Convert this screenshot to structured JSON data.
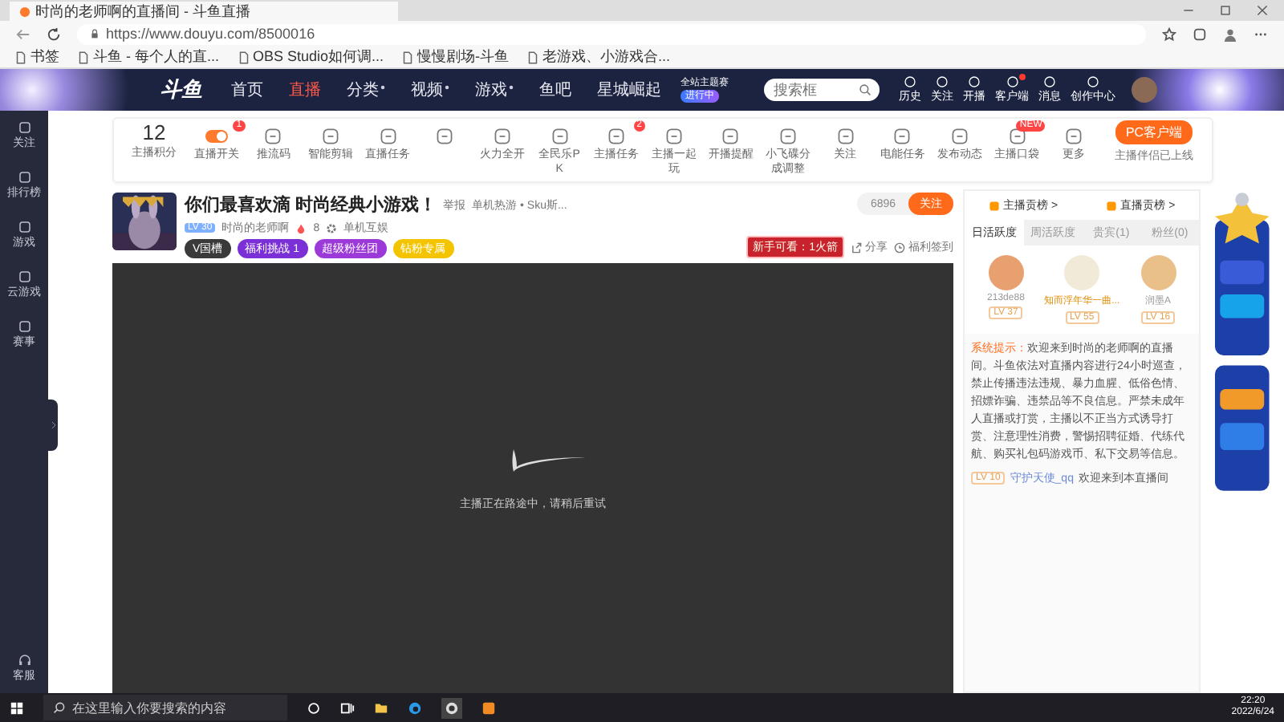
{
  "browser": {
    "tab_title": "时尚的老师啊的直播间 - 斗鱼直播",
    "url": "https://www.douyu.com/8500016",
    "bookmarks": [
      "书签",
      "斗鱼 - 每个人的直...",
      "OBS Studio如何调...",
      "慢慢剧场-斗鱼",
      "老游戏、小游戏合..."
    ]
  },
  "header": {
    "logo": "斗鱼",
    "nav": [
      {
        "label": "首页",
        "selected": false,
        "dropdown": false
      },
      {
        "label": "直播",
        "selected": true,
        "dropdown": false
      },
      {
        "label": "分类",
        "selected": false,
        "dropdown": true
      },
      {
        "label": "视频",
        "selected": false,
        "dropdown": true
      },
      {
        "label": "游戏",
        "selected": false,
        "dropdown": true
      },
      {
        "label": "鱼吧",
        "selected": false,
        "dropdown": false
      },
      {
        "label": "星城崛起",
        "selected": false,
        "dropdown": false
      }
    ],
    "event": {
      "title": "全站主题赛",
      "status": "进行中"
    },
    "search": {
      "placeholder": "搜索框"
    },
    "actions": [
      {
        "label": "历史",
        "notify": false
      },
      {
        "label": "关注",
        "notify": false
      },
      {
        "label": "开播",
        "notify": false
      },
      {
        "label": "客户端",
        "notify": true
      },
      {
        "label": "消息",
        "notify": false
      },
      {
        "label": "创作中心",
        "notify": false
      }
    ]
  },
  "sidebar": {
    "items": [
      "关注",
      "排行榜",
      "游戏",
      "云游戏",
      "赛事"
    ],
    "bottom": "客服"
  },
  "toolbar": {
    "score": "12",
    "score_label": "主播积分",
    "items": [
      {
        "label": "直播开关",
        "kind": "toggle",
        "on": true,
        "badge": "1"
      },
      {
        "label": "推流码",
        "kind": "icon"
      },
      {
        "label": "智能剪辑",
        "kind": "icon"
      },
      {
        "label": "直播任务",
        "kind": "icon"
      },
      {
        "kind": "icon"
      },
      {
        "label": "火力全开",
        "kind": "icon"
      },
      {
        "label": "全民乐PK",
        "kind": "icon"
      },
      {
        "label": "主播任务",
        "kind": "icon",
        "badge": "2"
      },
      {
        "label": "主播一起玩",
        "kind": "icon"
      },
      {
        "label": "开播提醒",
        "kind": "icon"
      },
      {
        "label": "小飞碟分成调整",
        "kind": "icon"
      },
      {
        "label": "关注",
        "kind": "icon"
      },
      {
        "label": "电能任务",
        "kind": "icon"
      },
      {
        "label": "发布动态",
        "kind": "icon"
      },
      {
        "label": "主播口袋",
        "kind": "icon",
        "badge": "NEW"
      },
      {
        "label": "更多",
        "kind": "icon"
      }
    ],
    "client_button": "PC客户端",
    "client_note": "主播伴侣已上线"
  },
  "stream": {
    "title": "你们最喜欢滴 时尚经典小游戏！",
    "report": "举报",
    "category": "单机热游 • Sku斯...",
    "level": "LV 30",
    "streamer": "时尚的老师啊",
    "heat": "8",
    "tag": "单机互娱",
    "chips": [
      {
        "label": "V国槽",
        "color": "#3a3a3a"
      },
      {
        "label": "福利挑战 1",
        "color": "#7b2fd6"
      },
      {
        "label": "超级粉丝团",
        "color": "#9b3ad8"
      },
      {
        "label": "钻粉专属",
        "color": "#f5c400"
      }
    ],
    "followers": "6896",
    "follow_button": "关注",
    "promo": "新手可看：1火箭",
    "share": "分享",
    "checkin": "福利签到"
  },
  "video": {
    "message": "主播正在路途中，请稍后重试"
  },
  "panel": {
    "ranks": [
      "主播贡榜 >",
      "直播贡榜 >"
    ],
    "tabs": [
      {
        "label": "日活跃度",
        "selected": true
      },
      {
        "label": "周活跃度",
        "selected": false
      },
      {
        "label": "贵宾(1)",
        "selected": false
      },
      {
        "label": "粉丝(0)",
        "selected": false
      }
    ],
    "top": [
      {
        "name": "213de88",
        "level": "LV 37",
        "highlight": false
      },
      {
        "name": "知而浮年华一曲...",
        "level": "LV 55",
        "highlight": true
      },
      {
        "name": "润墨A",
        "level": "LV 16",
        "highlight": false
      }
    ],
    "system_label": "系统提示：",
    "system_text": "欢迎来到时尚的老师啊的直播间。斗鱼依法对直播内容进行24小时巡查，禁止传播违法违规、暴力血腥、低俗色情、招嫖诈骗、违禁品等不良信息。严禁未成年人直播或打赏，主播以不正当方式诱导打赏、注意理性消费，警惕招聘征婚、代练代航、购买礼包码游戏币、私下交易等信息。",
    "welcome": {
      "level": "LV 10",
      "user": "守护天使_qq",
      "text": "欢迎来到本直播间"
    }
  },
  "taskbar": {
    "search": {
      "placeholder": "在这里输入你要搜索的内容"
    },
    "time": "22:20",
    "date": "2022/6/24"
  }
}
